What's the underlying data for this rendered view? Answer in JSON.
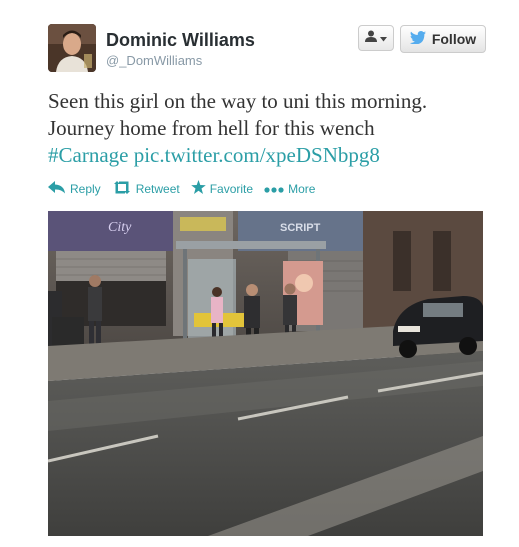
{
  "user": {
    "display_name": "Dominic Williams",
    "handle": "@_DomWilliams"
  },
  "buttons": {
    "follow_label": "Follow"
  },
  "tweet": {
    "text_line1": "Seen this girl on the way to uni this morning.",
    "text_line2": "Journey home from hell for this wench",
    "hashtag": "#Carnage",
    "pic_link": "pic.twitter.com/xpeDSNbpg8"
  },
  "actions": {
    "reply": "Reply",
    "retweet": "Retweet",
    "favorite": "Favorite",
    "more": "More"
  },
  "photo": {
    "sign_text": "SCRIPT"
  },
  "colors": {
    "link": "#2b9ea6",
    "twitter_blue": "#55acee"
  }
}
